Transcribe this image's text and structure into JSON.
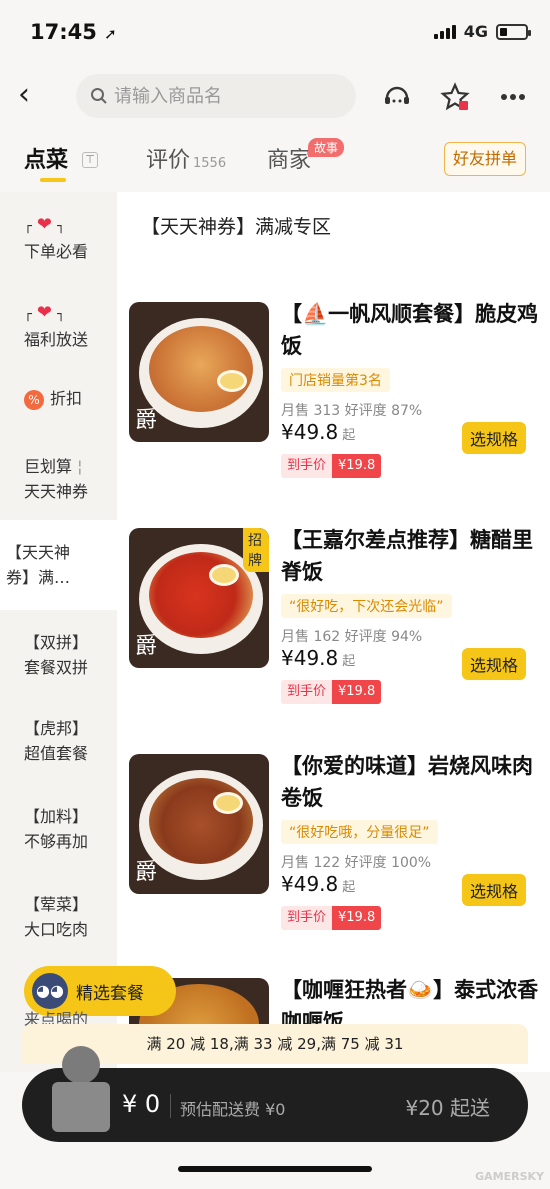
{
  "status": {
    "time": "17:45",
    "network": "4G"
  },
  "search": {
    "placeholder": "请输入商品名"
  },
  "tabs": {
    "order": "点菜",
    "reviews": "评价",
    "reviews_count": "1556",
    "merchant": "商家",
    "merchant_badge": "故事",
    "friend_order": "好友拼单"
  },
  "sidebar": {
    "items": [
      {
        "label": "下单必看"
      },
      {
        "label": "福利放送"
      },
      {
        "label": "折扣"
      },
      {
        "label_1": "巨划算",
        "label_2": "天天神券"
      },
      {
        "label_1": "【天天神",
        "label_2": "券】满…"
      },
      {
        "label_1": "【双拼】",
        "label_2": "套餐双拼"
      },
      {
        "label_1": "【虎邦】",
        "label_2": "超值套餐"
      },
      {
        "label_1": "【加料】",
        "label_2": "不够再加"
      },
      {
        "label_1": "【荤菜】",
        "label_2": "大口吃肉"
      }
    ],
    "partial": "来点喝的"
  },
  "section_title": "【天天神券】满减专区",
  "products": [
    {
      "name": "【⛵一帆风顺套餐】脆皮鸡饭",
      "badge": "门店销量第3名",
      "sales": "月售 313  好评度 87%",
      "price": "¥49.8",
      "price_suffix": "起",
      "spec": "选规格",
      "final_label": "到手价",
      "final_value": "¥19.8"
    },
    {
      "name": "【王嘉尔差点推荐】糖醋里脊饭",
      "tag": "招牌",
      "badge": "“很好吃，下次还会光临”",
      "sales": "月售 162  好评度 94%",
      "price": "¥49.8",
      "price_suffix": "起",
      "spec": "选规格",
      "final_label": "到手价",
      "final_value": "¥19.8"
    },
    {
      "name": "【你爱的味道】岩烧风味肉卷饭",
      "badge": "“很好吃哦，分量很足”",
      "sales": "月售 122  好评度 100%",
      "price": "¥49.8",
      "price_suffix": "起",
      "spec": "选规格",
      "final_label": "到手价",
      "final_value": "¥19.8"
    },
    {
      "name": "【咖喱狂热者🍛】泰式浓香咖喱饭"
    }
  ],
  "featured": "精选套餐",
  "promo": "满 20 减 18,满 33 减 29,满 75 减 31",
  "cart": {
    "total": "¥ 0",
    "fee": "预估配送费 ¥0",
    "min_order": "¥20 起送"
  },
  "watermark": "GAMERSKY"
}
